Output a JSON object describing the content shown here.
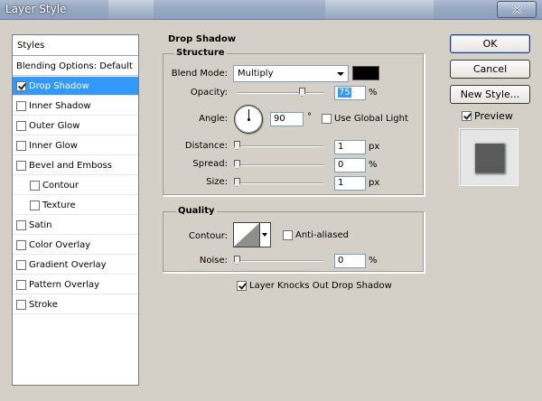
{
  "window": {
    "title": "Layer Style"
  },
  "styles_list": {
    "header": "Styles",
    "items": [
      {
        "label": "Blending Options: Default",
        "has_checkbox": false,
        "checked": false,
        "selected": false,
        "indent": false
      },
      {
        "label": "Drop Shadow",
        "has_checkbox": true,
        "checked": true,
        "selected": true,
        "indent": false
      },
      {
        "label": "Inner Shadow",
        "has_checkbox": true,
        "checked": false,
        "selected": false,
        "indent": false
      },
      {
        "label": "Outer Glow",
        "has_checkbox": true,
        "checked": false,
        "selected": false,
        "indent": false
      },
      {
        "label": "Inner Glow",
        "has_checkbox": true,
        "checked": false,
        "selected": false,
        "indent": false
      },
      {
        "label": "Bevel and Emboss",
        "has_checkbox": true,
        "checked": false,
        "selected": false,
        "indent": false
      },
      {
        "label": "Contour",
        "has_checkbox": true,
        "checked": false,
        "selected": false,
        "indent": true
      },
      {
        "label": "Texture",
        "has_checkbox": true,
        "checked": false,
        "selected": false,
        "indent": true
      },
      {
        "label": "Satin",
        "has_checkbox": true,
        "checked": false,
        "selected": false,
        "indent": false
      },
      {
        "label": "Color Overlay",
        "has_checkbox": true,
        "checked": false,
        "selected": false,
        "indent": false
      },
      {
        "label": "Gradient Overlay",
        "has_checkbox": true,
        "checked": false,
        "selected": false,
        "indent": false
      },
      {
        "label": "Pattern Overlay",
        "has_checkbox": true,
        "checked": false,
        "selected": false,
        "indent": false
      },
      {
        "label": "Stroke",
        "has_checkbox": true,
        "checked": false,
        "selected": false,
        "indent": false
      }
    ]
  },
  "drop_shadow": {
    "title": "Drop Shadow",
    "structure": {
      "title": "Structure",
      "blend_mode_label": "Blend Mode:",
      "blend_mode_value": "Multiply",
      "shadow_color": "#000000",
      "opacity_label": "Opacity:",
      "opacity_value": "75",
      "opacity_unit": "%",
      "opacity_level": 0.75,
      "angle_label": "Angle:",
      "angle_value": "90",
      "angle_unit": "°",
      "use_global_light_label": "Use Global Light",
      "use_global_light_checked": false,
      "distance_label": "Distance:",
      "distance_value": "1",
      "distance_unit": "px",
      "spread_label": "Spread:",
      "spread_value": "0",
      "spread_unit": "%",
      "size_label": "Size:",
      "size_value": "1",
      "size_unit": "px"
    },
    "quality": {
      "title": "Quality",
      "contour_label": "Contour:",
      "anti_aliased_label": "Anti-aliased",
      "anti_aliased_checked": false,
      "noise_label": "Noise:",
      "noise_value": "0",
      "noise_unit": "%"
    },
    "knockout_label": "Layer Knocks Out Drop Shadow",
    "knockout_checked": true
  },
  "buttons": {
    "ok": "OK",
    "cancel": "Cancel",
    "new_style": "New Style..."
  },
  "preview": {
    "label": "Preview",
    "checked": true
  }
}
